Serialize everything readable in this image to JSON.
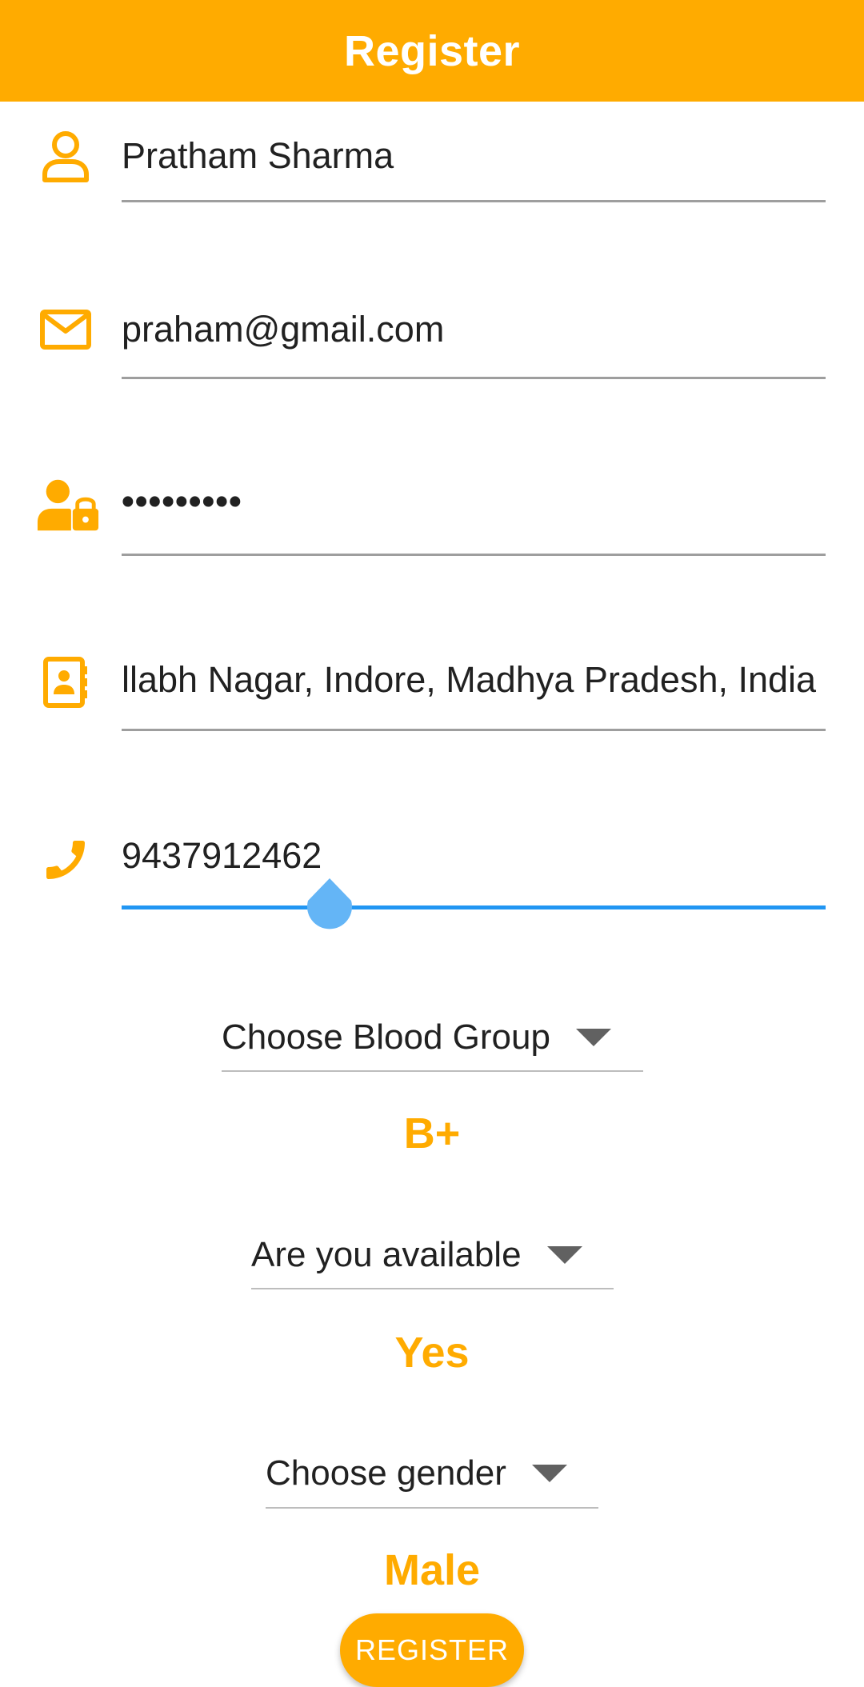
{
  "app_bar": {
    "title": "Register",
    "color": "#FFAB00"
  },
  "fields": [
    {
      "icon": "person-icon",
      "value": "Pratham Sharma",
      "focused": false
    },
    {
      "icon": "email-icon",
      "value": "praham@gmail.com",
      "focused": false
    },
    {
      "icon": "user-lock-icon",
      "value": "•••••••••",
      "focused": false
    },
    {
      "icon": "contact-card-icon",
      "value": "llabh Nagar, Indore, Madhya Pradesh, India",
      "focused": false
    },
    {
      "icon": "phone-icon",
      "value": "9437912462",
      "focused": true
    }
  ],
  "dropdowns": {
    "blood_group": {
      "label": "Choose Blood Group",
      "selected": "B+"
    },
    "availability": {
      "label": "Are you available",
      "selected": "Yes"
    },
    "gender": {
      "label": "Choose gender",
      "selected": "Male"
    }
  },
  "register_button": {
    "label": "REGISTER"
  },
  "colors": {
    "accent": "#FFAB00",
    "focus": "#2196F3",
    "cursor_handle": "#64B5F6"
  }
}
